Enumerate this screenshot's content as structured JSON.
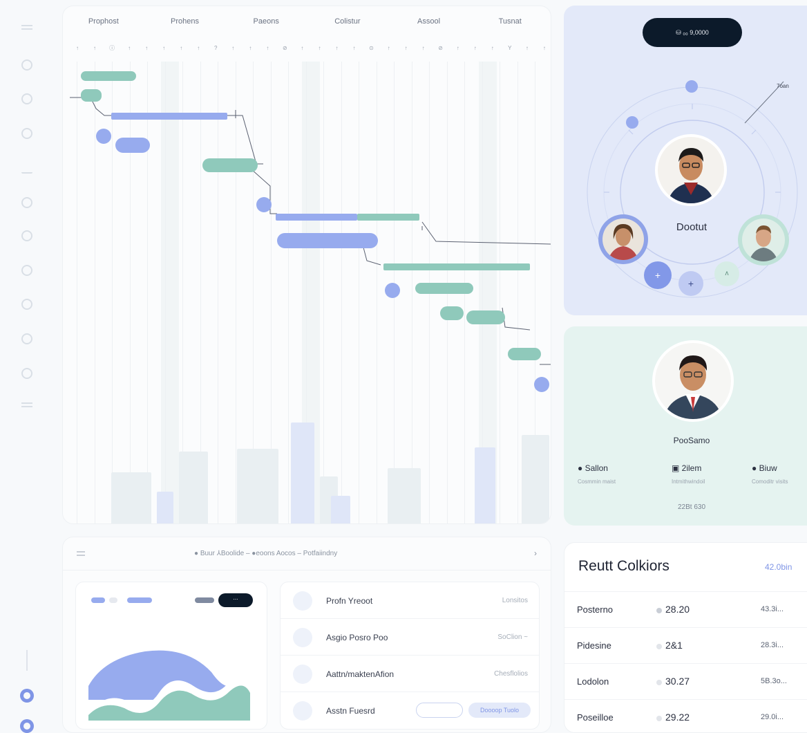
{
  "gantt": {
    "headers": [
      "Prophost",
      "Prohens",
      "Paeons",
      "Colistur",
      "Assool",
      "Tusnat"
    ],
    "ticks": [
      "↑",
      "↑",
      "ⓘ",
      "↑",
      "↑",
      "↑",
      "↑",
      "↑",
      "?",
      "↑",
      "↑",
      "↑",
      "⊘",
      "↑",
      "↑",
      "↑",
      "↑",
      "⊙",
      "↑",
      "↑",
      "↑",
      "⊘",
      "↑",
      "↑",
      "↑",
      "Y",
      "↑",
      "↑"
    ]
  },
  "team": {
    "budget_pill": "⛁ ₀₀ 9,0000",
    "center_name": "Dootut",
    "side_label": "7oan",
    "buttons": [
      "+",
      "+",
      "ʌ"
    ]
  },
  "profile": {
    "name": "PooSamo",
    "stats": [
      {
        "title": "Sallon",
        "sub": "Cosmmin maist"
      },
      {
        "title": "2ilem",
        "sub": "Intmithwindoil"
      },
      {
        "title": "Biuw",
        "sub": "Comoditr visits"
      }
    ],
    "value": "22Bt 630"
  },
  "bottom": {
    "toolbar_text": "● Buur  ⅄Boolide  –  ●eoons  Aocos  –  Potfaiindny",
    "chart_toggle": "⋯"
  },
  "contacts": [
    {
      "name": "Profn Yreoot",
      "meta": "Lonsitos"
    },
    {
      "name": "Asgio Posro Poo",
      "meta": "SoClion ~"
    },
    {
      "name": "Aattn/maktenAfion",
      "meta": "Chesflolios"
    },
    {
      "name": "Asstn Fuesrd",
      "meta": "Doooop Tuolo"
    }
  ],
  "results": {
    "title": "Reutt Colkiors",
    "summary": "42.0bin",
    "rows": [
      {
        "name": "Posterno",
        "value": "28.20",
        "extra": "43.3i..."
      },
      {
        "name": "Pidesine",
        "value": "2&1",
        "extra": "28.3i..."
      },
      {
        "name": "Lodolon",
        "value": "30.27",
        "extra": "5B.3o..."
      },
      {
        "name": "Poseilloe",
        "value": "29.22",
        "extra": "29.0i..."
      }
    ]
  }
}
